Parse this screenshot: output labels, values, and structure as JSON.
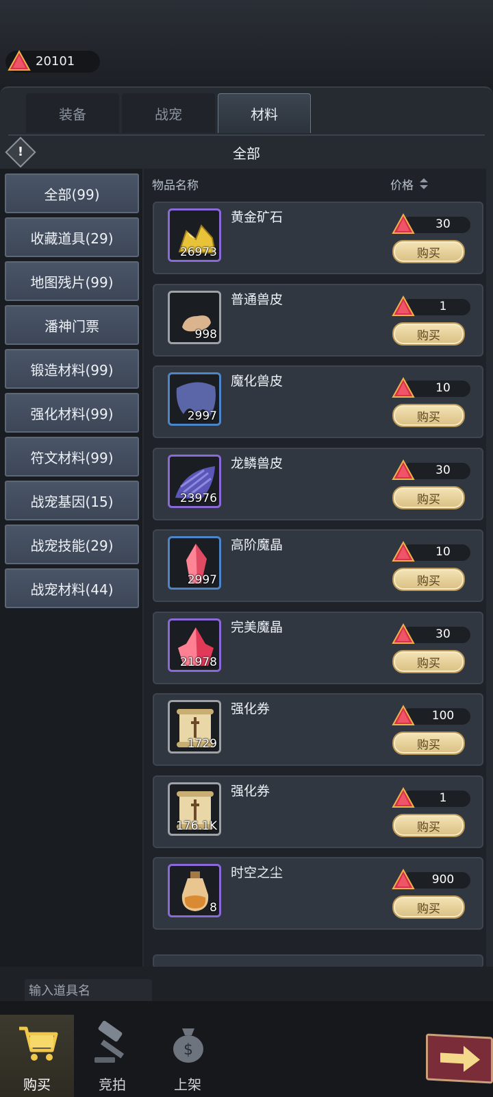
{
  "currency": {
    "amount": "20101"
  },
  "tabs": [
    {
      "label": "装备",
      "active": false
    },
    {
      "label": "战宠",
      "active": false
    },
    {
      "label": "材料",
      "active": true
    }
  ],
  "section_title": "全部",
  "categories": [
    "全部(99)",
    "收藏道具(29)",
    "地图残片(99)",
    "潘神门票",
    "锻造材料(99)",
    "强化材料(99)",
    "符文材料(99)",
    "战宠基因(15)",
    "战宠技能(29)",
    "战宠材料(44)"
  ],
  "columns": {
    "name": "物品名称",
    "price": "价格"
  },
  "items": [
    {
      "name": "黄金矿石",
      "qty": "26973",
      "price": "30",
      "icon": "gold-ore-icon",
      "rarity": "purple"
    },
    {
      "name": "普通兽皮",
      "qty": "998",
      "price": "1",
      "icon": "beast-hide-icon",
      "rarity": "gray"
    },
    {
      "name": "魔化兽皮",
      "qty": "2997",
      "price": "10",
      "icon": "magic-hide-icon",
      "rarity": "blue"
    },
    {
      "name": "龙鳞兽皮",
      "qty": "23976",
      "price": "30",
      "icon": "dragon-scale-hide-icon",
      "rarity": "purple"
    },
    {
      "name": "高阶魔晶",
      "qty": "2997",
      "price": "10",
      "icon": "crystal-icon",
      "rarity": "blue"
    },
    {
      "name": "完美魔晶",
      "qty": "21978",
      "price": "30",
      "icon": "perfect-crystal-icon",
      "rarity": "purple"
    },
    {
      "name": "强化券",
      "qty": "1729",
      "price": "100",
      "icon": "scroll-icon",
      "rarity": "gray"
    },
    {
      "name": "强化券",
      "qty": "176.1K",
      "price": "1",
      "icon": "scroll-icon",
      "rarity": "gray"
    },
    {
      "name": "时空之尘",
      "qty": "8",
      "price": "900",
      "icon": "dust-bottle-icon",
      "rarity": "purple"
    }
  ],
  "buy_label": "购买",
  "search": {
    "placeholder": "输入道具名"
  },
  "bottom_nav": [
    {
      "label": "购买",
      "icon": "shopping-cart-icon",
      "active": true
    },
    {
      "label": "竞拍",
      "icon": "auction-hammer-icon",
      "active": false
    },
    {
      "label": "上架",
      "icon": "money-bag-icon",
      "active": false
    }
  ],
  "colors": {
    "gem": "#d8324a",
    "buy_button": "#e8d39c",
    "panel": "#262b32"
  }
}
